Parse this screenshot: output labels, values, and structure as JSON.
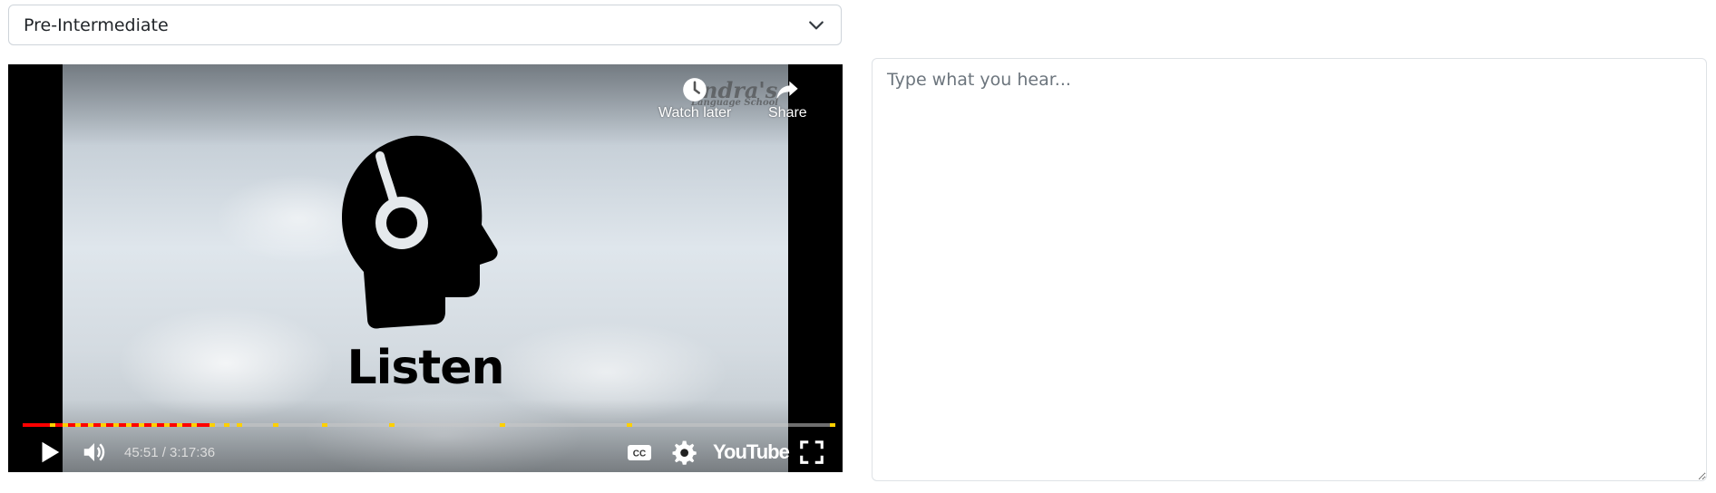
{
  "level_select": {
    "value": "Pre-Intermediate"
  },
  "video": {
    "title_overlay": "Listen",
    "channel_logo_main": "ndra's",
    "channel_logo_sub": "Language School",
    "watch_later_label": "Watch later",
    "share_label": "Share",
    "time_display": "45:51 / 3:17:36",
    "progress_fraction": 0.232,
    "youtube_label": "YouTube",
    "colors": {
      "played": "#ff0000",
      "chapter_marker": "#ffd000"
    },
    "icons": [
      "clock-icon",
      "share-arrow-icon",
      "play-icon",
      "volume-icon",
      "captions-icon",
      "gear-icon",
      "youtube-logo",
      "fullscreen-icon"
    ]
  },
  "answer_box": {
    "placeholder": "Type what you hear..."
  }
}
